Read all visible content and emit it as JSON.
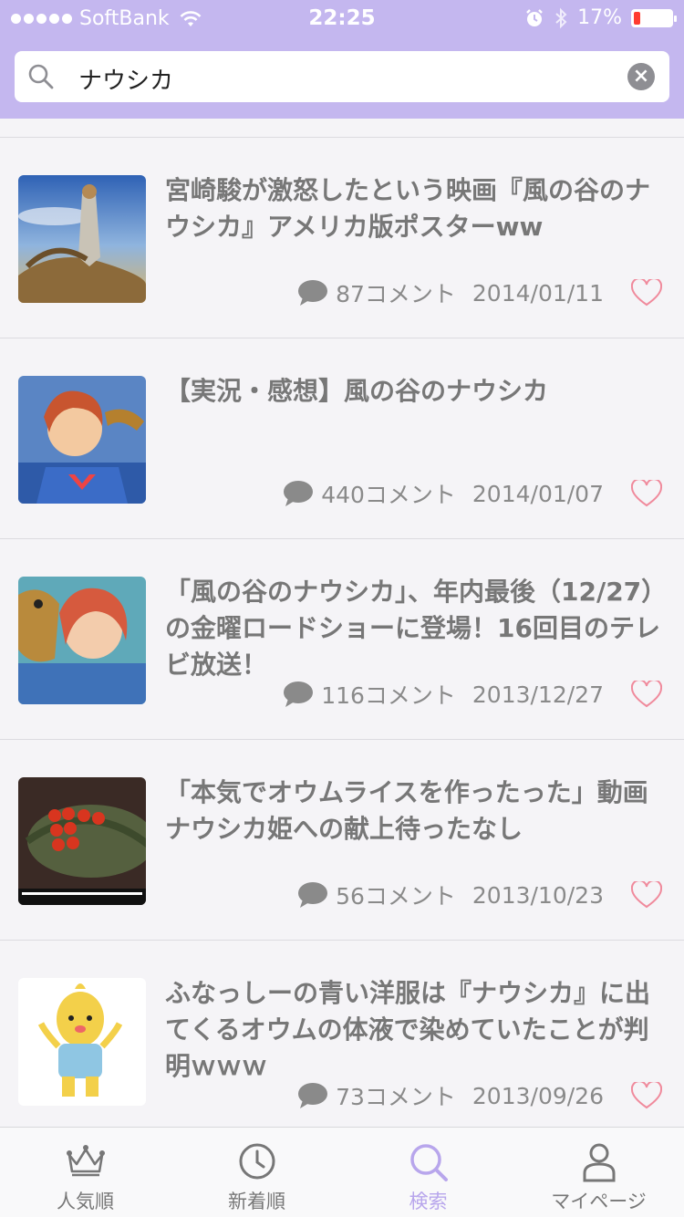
{
  "status": {
    "carrier": "SoftBank",
    "time": "22:25",
    "battery": "17%"
  },
  "search": {
    "query": "ナウシカ"
  },
  "articles": [
    {
      "title": "宮崎駿が激怒したという映画『風の谷のナウシカ』アメリカ版ポスターww",
      "comments": "87コメント",
      "date": "2014/01/11"
    },
    {
      "title": "【実況・感想】風の谷のナウシカ",
      "comments": "440コメント",
      "date": "2014/01/07"
    },
    {
      "title": "「風の谷のナウシカ」、年内最後（12/27）の金曜ロードショーに登場！16回目のテレビ放送！",
      "comments": "116コメント",
      "date": "2013/12/27"
    },
    {
      "title": "「本気でオウムライスを作ったった」動画　ナウシカ姫への献上待ったなし",
      "comments": "56コメント",
      "date": "2013/10/23"
    },
    {
      "title": "ふなっしーの青い洋服は『ナウシカ』に出てくるオウムの体液で染めていたことが判明ｗｗｗ",
      "comments": "73コメント",
      "date": "2013/09/26"
    }
  ],
  "tabs": [
    {
      "label": "人気順",
      "icon": "crown-icon"
    },
    {
      "label": "新着順",
      "icon": "clock-icon"
    },
    {
      "label": "検索",
      "icon": "search-icon",
      "active": true
    },
    {
      "label": "マイページ",
      "icon": "person-icon"
    }
  ],
  "colors": {
    "header": "#c4b7ef",
    "accent": "#b8a6ec",
    "heart": "#f08a9c"
  }
}
